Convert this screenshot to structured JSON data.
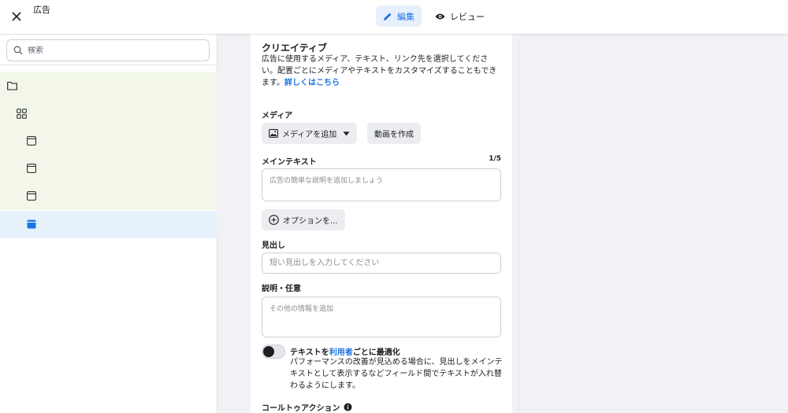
{
  "header": {
    "title": "広告",
    "tabs": [
      {
        "label": "編集",
        "icon": "pencil-icon",
        "active": true
      },
      {
        "label": "レビュー",
        "icon": "eye-icon",
        "active": false
      }
    ]
  },
  "sidebar": {
    "search_placeholder": "検索",
    "tree": [
      {
        "icon": "folder-icon",
        "state": "campaign"
      },
      {
        "icon": "grid-icon",
        "state": "adset"
      },
      {
        "icon": "ad-icon",
        "state": "ad"
      },
      {
        "icon": "ad-icon",
        "state": "ad"
      },
      {
        "icon": "ad-icon",
        "state": "ad"
      },
      {
        "icon": "ad-icon",
        "state": "selected"
      }
    ]
  },
  "creative": {
    "title": "クリエイティブ",
    "description": "広告に使用するメディア、テキスト、リンク先を選択してください。配置ごとにメディアやテキストをカスタマイズすることもできます。",
    "learn_more": "詳しくはこちら",
    "media": {
      "label": "メディア",
      "add_media": "メディアを追加",
      "create_video": "動画を作成"
    },
    "primary_text": {
      "label": "メインテキスト",
      "counter": "1/5",
      "placeholder": "広告の簡単な説明を追加しましょう",
      "options_button": "オプションを..."
    },
    "headline": {
      "label": "見出し",
      "placeholder": "短い見出しを入力してください"
    },
    "description_field": {
      "label": "説明・任意",
      "placeholder": "その他の情報を追加"
    },
    "optimize": {
      "title_before": "テキストを",
      "title_highlight": "利用者",
      "title_after": "ごとに最適化",
      "text": "パフォーマンスの改善が見込める場合に、見出しをメインテキストとして表示するなどフィールド間でテキストが入れ替わるようにします。"
    },
    "cta": {
      "label": "コールトゥアクション"
    }
  },
  "colors": {
    "accent": "#1b74e4",
    "tree_highlight": "#f2f7e9",
    "tree_selected": "#e7f1fc"
  }
}
